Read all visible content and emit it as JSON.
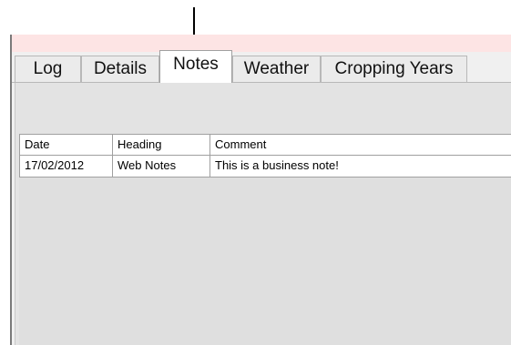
{
  "tabs": [
    {
      "label": "Log"
    },
    {
      "label": "Details"
    },
    {
      "label": "Notes",
      "active": true
    },
    {
      "label": "Weather"
    },
    {
      "label": "Cropping Years"
    }
  ],
  "grid": {
    "columns": [
      "Date",
      "Heading",
      "Comment"
    ],
    "rows": [
      {
        "date": "17/02/2012",
        "heading": "Web Notes",
        "comment": "This is a business note!"
      }
    ]
  },
  "colors": {
    "title_strip": "#fde4e4",
    "panel": "#f0f0f0",
    "tab_page": "#e3e3e3",
    "grid_background": "#dfdfdf",
    "active_tab": "#ffffff"
  },
  "annotation": {
    "icon": "down-arrow-icon"
  }
}
